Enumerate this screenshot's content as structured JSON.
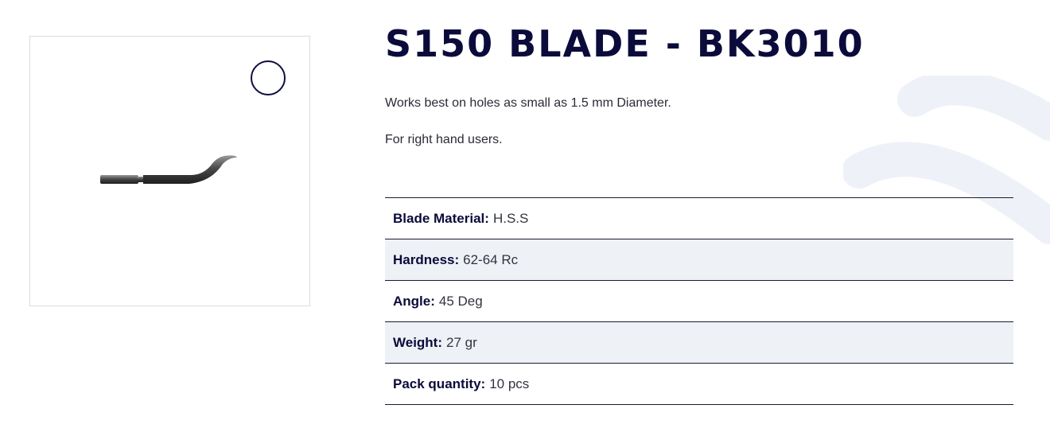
{
  "product": {
    "title": "S150 BLADE - BK3010",
    "description": [
      "Works best on holes as small as 1.5 mm Diameter.",
      "For right hand users."
    ],
    "image_icon": "deburring-blade-image"
  },
  "specs": [
    {
      "key": "Blade Material:",
      "value": "H.S.S"
    },
    {
      "key": "Hardness:",
      "value": "62-64 Rc"
    },
    {
      "key": "Angle:",
      "value": "45 Deg"
    },
    {
      "key": "Weight:",
      "value": "27 gr"
    },
    {
      "key": "Pack quantity:",
      "value": "10 pcs"
    }
  ],
  "colors": {
    "title": "#0b0b3b",
    "row_alt": "#eef1f6",
    "rule": "#1a1a33",
    "deco": "#eef2f8"
  }
}
